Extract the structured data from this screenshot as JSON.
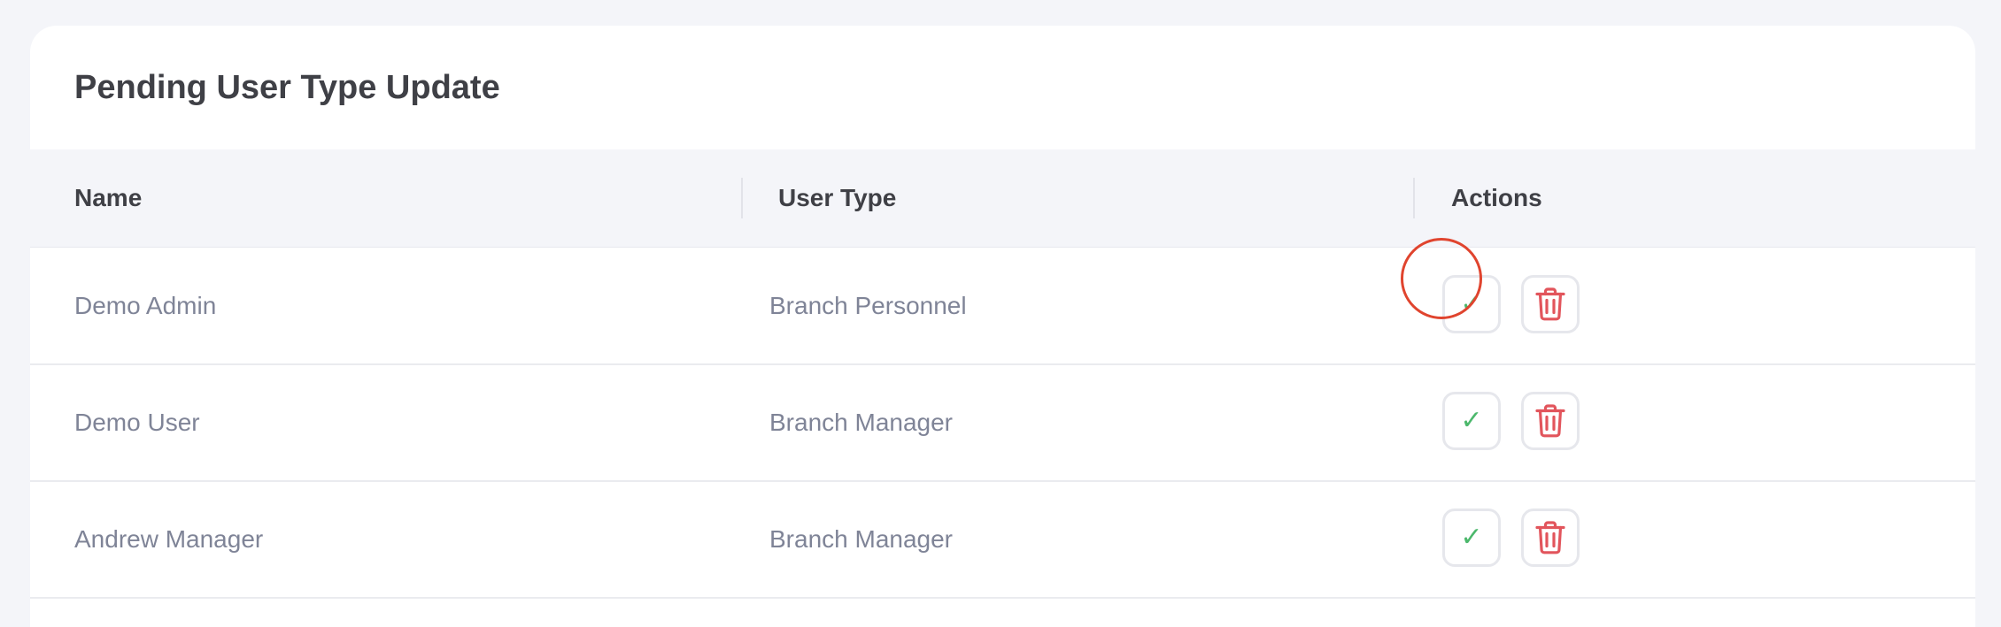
{
  "title": "Pending User Type Update",
  "columns": {
    "name": "Name",
    "user_type": "User Type",
    "actions": "Actions"
  },
  "rows": [
    {
      "name": "Demo Admin",
      "user_type": "Branch Personnel"
    },
    {
      "name": "Demo User",
      "user_type": "Branch Manager"
    },
    {
      "name": "Andrew Manager",
      "user_type": "Branch Manager"
    }
  ],
  "icons": {
    "approve": "check-icon",
    "delete": "trash-icon",
    "approve_glyph": "✓"
  },
  "colors": {
    "approve": "#4cb86c",
    "delete": "#e2555c",
    "highlight_ring": "#e0442e",
    "heading_text": "#3f4046",
    "body_text": "#7f8497"
  }
}
